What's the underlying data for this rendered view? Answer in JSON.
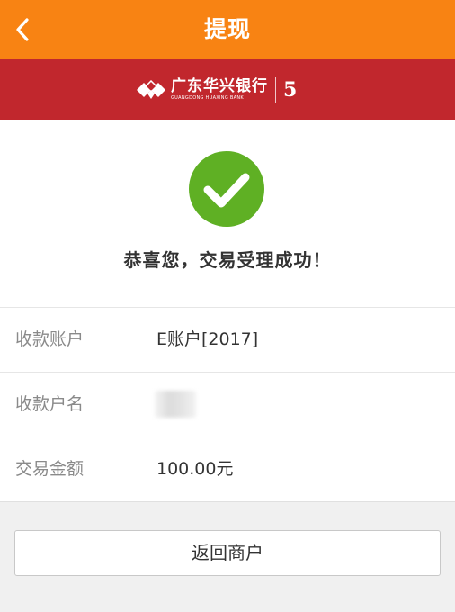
{
  "header": {
    "title": "提现",
    "back_icon": "chevron-left-icon"
  },
  "bank": {
    "name_cn": "广东华兴银行",
    "name_en": "GUANGDONG HUAXING BANK",
    "badge": "5"
  },
  "result": {
    "icon": "check-circle-icon",
    "message": "恭喜您，交易受理成功！"
  },
  "details": [
    {
      "label": "收款账户",
      "value": "E账户[2017]"
    },
    {
      "label": "收款户名",
      "value": ""
    },
    {
      "label": "交易金额",
      "value": "100.00元"
    }
  ],
  "actions": {
    "return_label": "返回商户"
  },
  "colors": {
    "header_bg": "#f88313",
    "bank_bg": "#c1272d",
    "success_green": "#5fb024"
  }
}
